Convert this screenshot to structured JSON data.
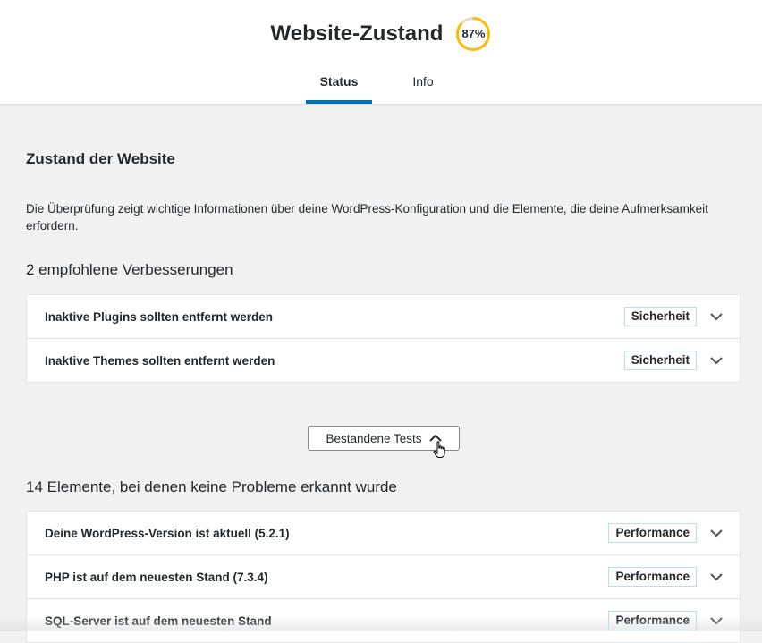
{
  "header": {
    "title": "Website-Zustand",
    "score": "87%",
    "score_value": 87,
    "tabs": [
      {
        "label": "Status",
        "active": true
      },
      {
        "label": "Info",
        "active": false
      }
    ]
  },
  "main": {
    "section_title": "Zustand der Website",
    "description": "Die Überprüfung zeigt wichtige Informationen über deine WordPress-Konfiguration und die Elemente, die deine Aufmerksamkeit erfordern.",
    "recommended": {
      "title": "2 empfohlene Verbesserungen",
      "items": [
        {
          "label": "Inaktive Plugins sollten entfernt werden",
          "badge": "Sicherheit"
        },
        {
          "label": "Inaktive Themes sollten entfernt werden",
          "badge": "Sicherheit"
        }
      ]
    },
    "toggle_button": "Bestandene Tests",
    "passed": {
      "title": "14 Elemente, bei denen keine Probleme erkannt wurde",
      "items": [
        {
          "label": "Deine WordPress-Version ist aktuell (5.2.1)",
          "badge": "Performance"
        },
        {
          "label": "PHP ist auf dem neuesten Stand (7.3.4)",
          "badge": "Performance"
        },
        {
          "label": "SQL-Server ist auf dem neuesten Stand",
          "badge": "Performance"
        }
      ]
    }
  },
  "colors": {
    "accent": "#0073aa",
    "progress": "#ffb900",
    "badge_border": "#b5e1e9"
  },
  "icons": {
    "expand": "chevron-down-icon",
    "collapse": "chevron-up-icon",
    "cursor": "hand-pointer-icon"
  }
}
